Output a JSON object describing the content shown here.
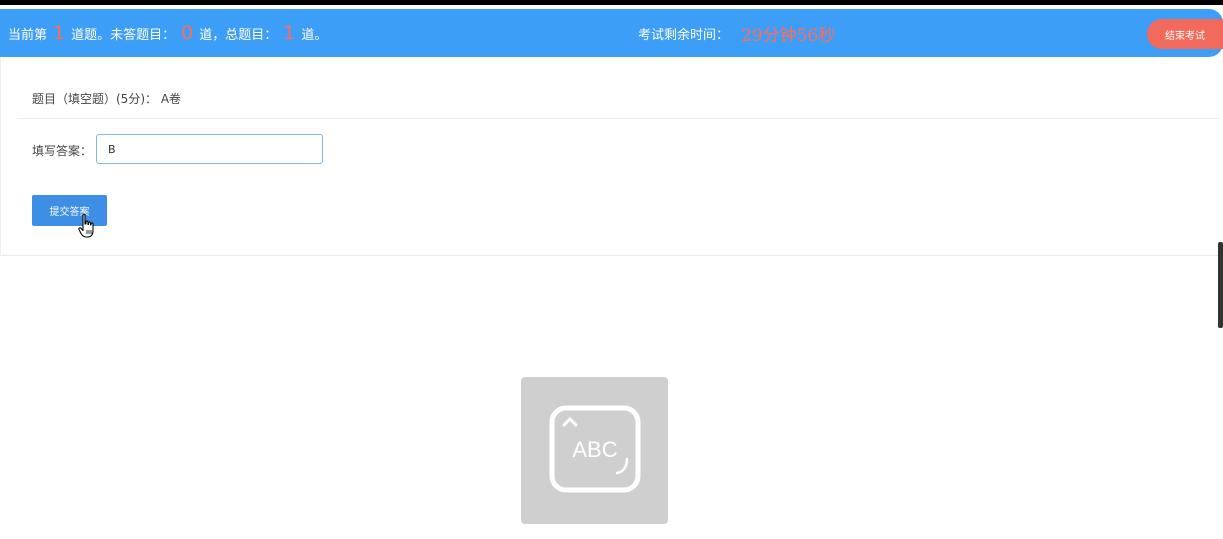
{
  "exam_bar": {
    "current_prefix": "当前第",
    "current_num": "1",
    "current_suffix": "道题。未答题目：",
    "unanswered_num": "0",
    "unanswered_suffix": "道，总题目：",
    "total_num": "1",
    "total_suffix": "道。",
    "time_label": "考试剩余时间：",
    "time_value": "29分钟56秒",
    "end_button": "结束考试"
  },
  "question": {
    "text": "题目（填空题）(5分)：  A卷"
  },
  "answer": {
    "label": "填写答案：",
    "value": "B"
  },
  "submit_button": "提交答案",
  "ime_badge": {
    "text": "ABC"
  },
  "colors": {
    "bar": "#3d9ef7",
    "accent_red": "#ff6b5b",
    "end_button": "#f26a5b",
    "submit_button": "#3d8fe5"
  },
  "icons": [
    "hand-pointer-icon",
    "keyboard-abc-icon"
  ]
}
